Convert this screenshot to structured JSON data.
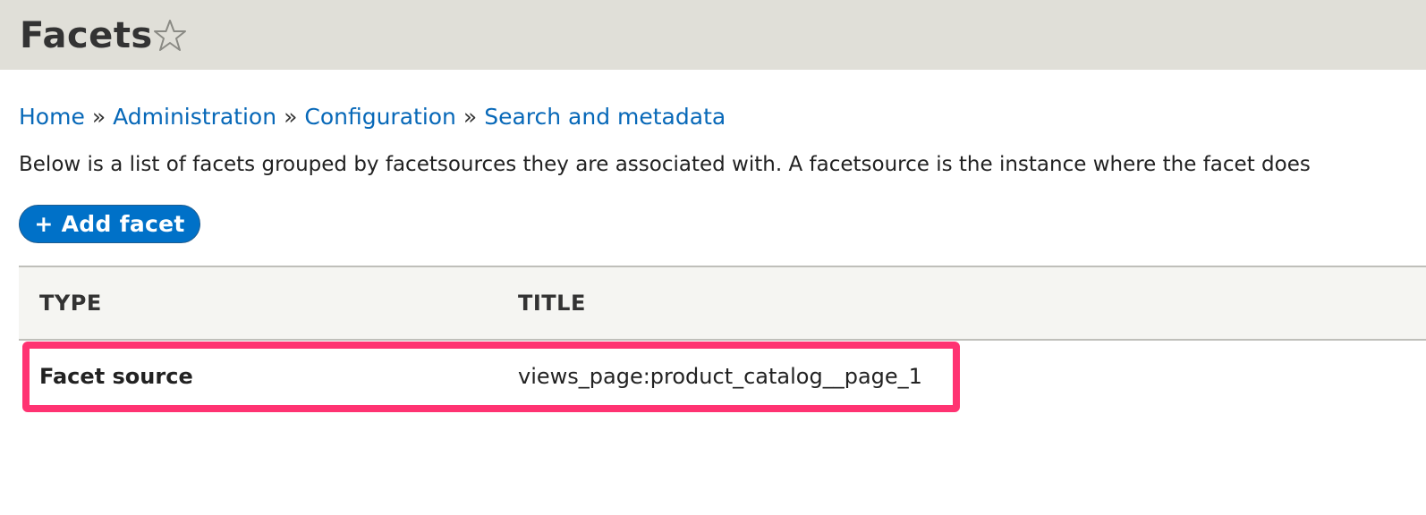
{
  "header": {
    "title": "Facets",
    "favorite_icon": "star-outline-icon"
  },
  "breadcrumb": {
    "items": [
      "Home",
      "Administration",
      "Configuration",
      "Search and metadata"
    ],
    "separator": "»"
  },
  "description": "Below is a list of facets grouped by facetsources they are associated with. A facetsource is the instance where the facet does",
  "actions": {
    "add_facet_label": "+ Add facet"
  },
  "table": {
    "columns": [
      "TYPE",
      "TITLE"
    ],
    "rows": [
      {
        "type": "Facet source",
        "title": "views_page:product_catalog__page_1"
      }
    ]
  },
  "colors": {
    "header_bg": "#e0dfd8",
    "link": "#0768b8",
    "button_bg": "#0071c8",
    "highlight": "#ff3372"
  }
}
